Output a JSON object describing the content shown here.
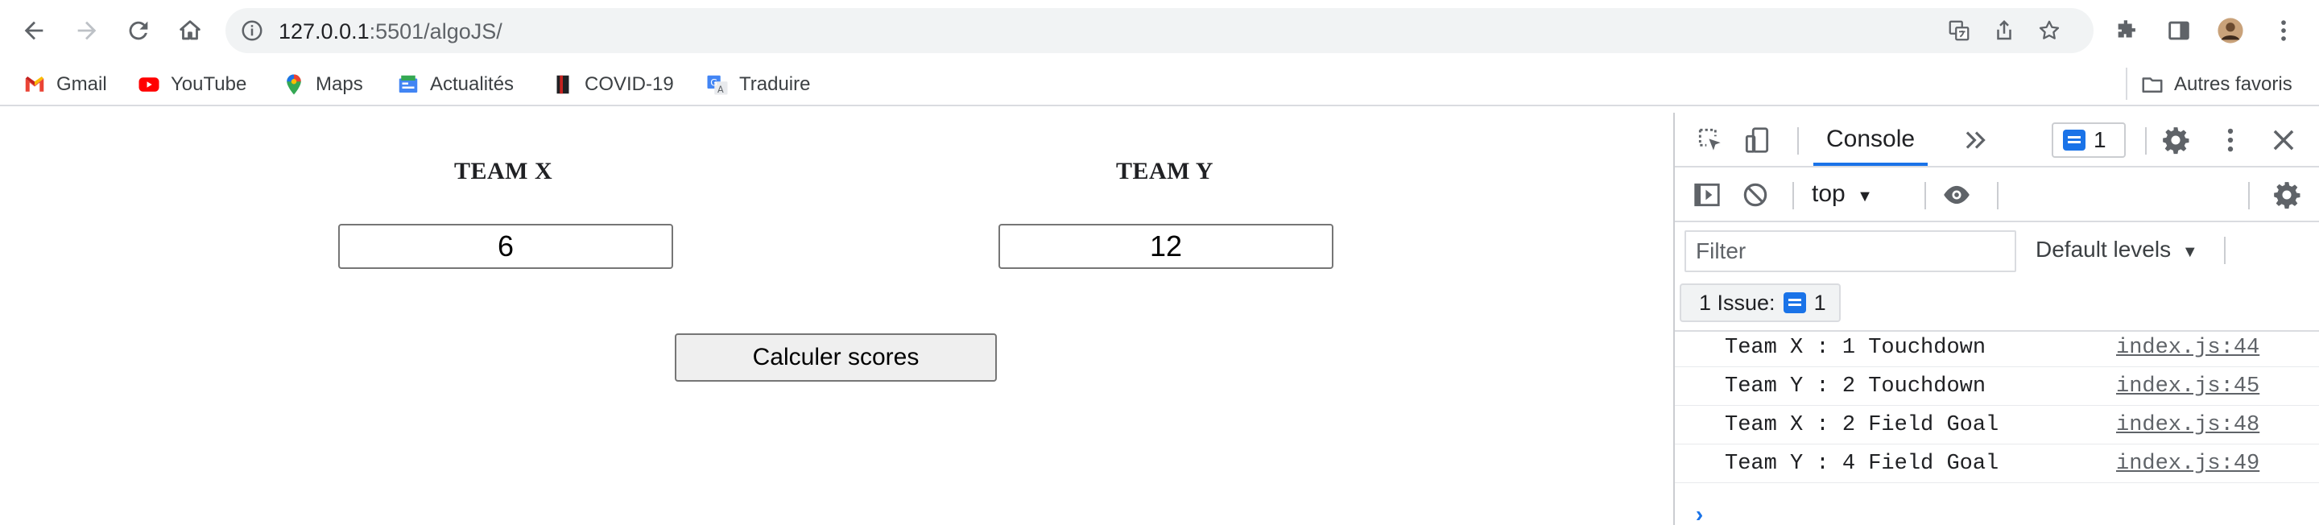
{
  "browser": {
    "url_host": "127.0.0.1",
    "url_path": ":5501/algoJS/"
  },
  "bookmarks": [
    {
      "label": "Gmail",
      "icon": "gmail-icon"
    },
    {
      "label": "YouTube",
      "icon": "youtube-icon"
    },
    {
      "label": "Maps",
      "icon": "maps-icon"
    },
    {
      "label": "Actualités",
      "icon": "news-icon"
    },
    {
      "label": "COVID-19",
      "icon": "covid-icon"
    },
    {
      "label": "Traduire",
      "icon": "translate-icon"
    }
  ],
  "other_bookmarks": "Autres favoris",
  "page": {
    "team_x": {
      "title": "TEAM X",
      "value": "6"
    },
    "team_y": {
      "title": "TEAM Y",
      "value": "12"
    },
    "calc_button": "Calculer scores"
  },
  "devtools": {
    "tab_console": "Console",
    "message_count": "1",
    "context": "top",
    "filter_placeholder": "Filter",
    "levels": "Default levels",
    "issues_label": "1 Issue:",
    "issues_count": "1",
    "logs": [
      {
        "message": "Team X : 1 Touchdown",
        "source": "index.js:44"
      },
      {
        "message": "Team Y : 2 Touchdown",
        "source": "index.js:45"
      },
      {
        "message": "Team X : 2 Field Goal",
        "source": "index.js:48"
      },
      {
        "message": "Team Y : 4 Field Goal",
        "source": "index.js:49"
      }
    ]
  },
  "colors": {
    "accent": "#1a73e8",
    "toolbar_icon": "#5f6368"
  }
}
